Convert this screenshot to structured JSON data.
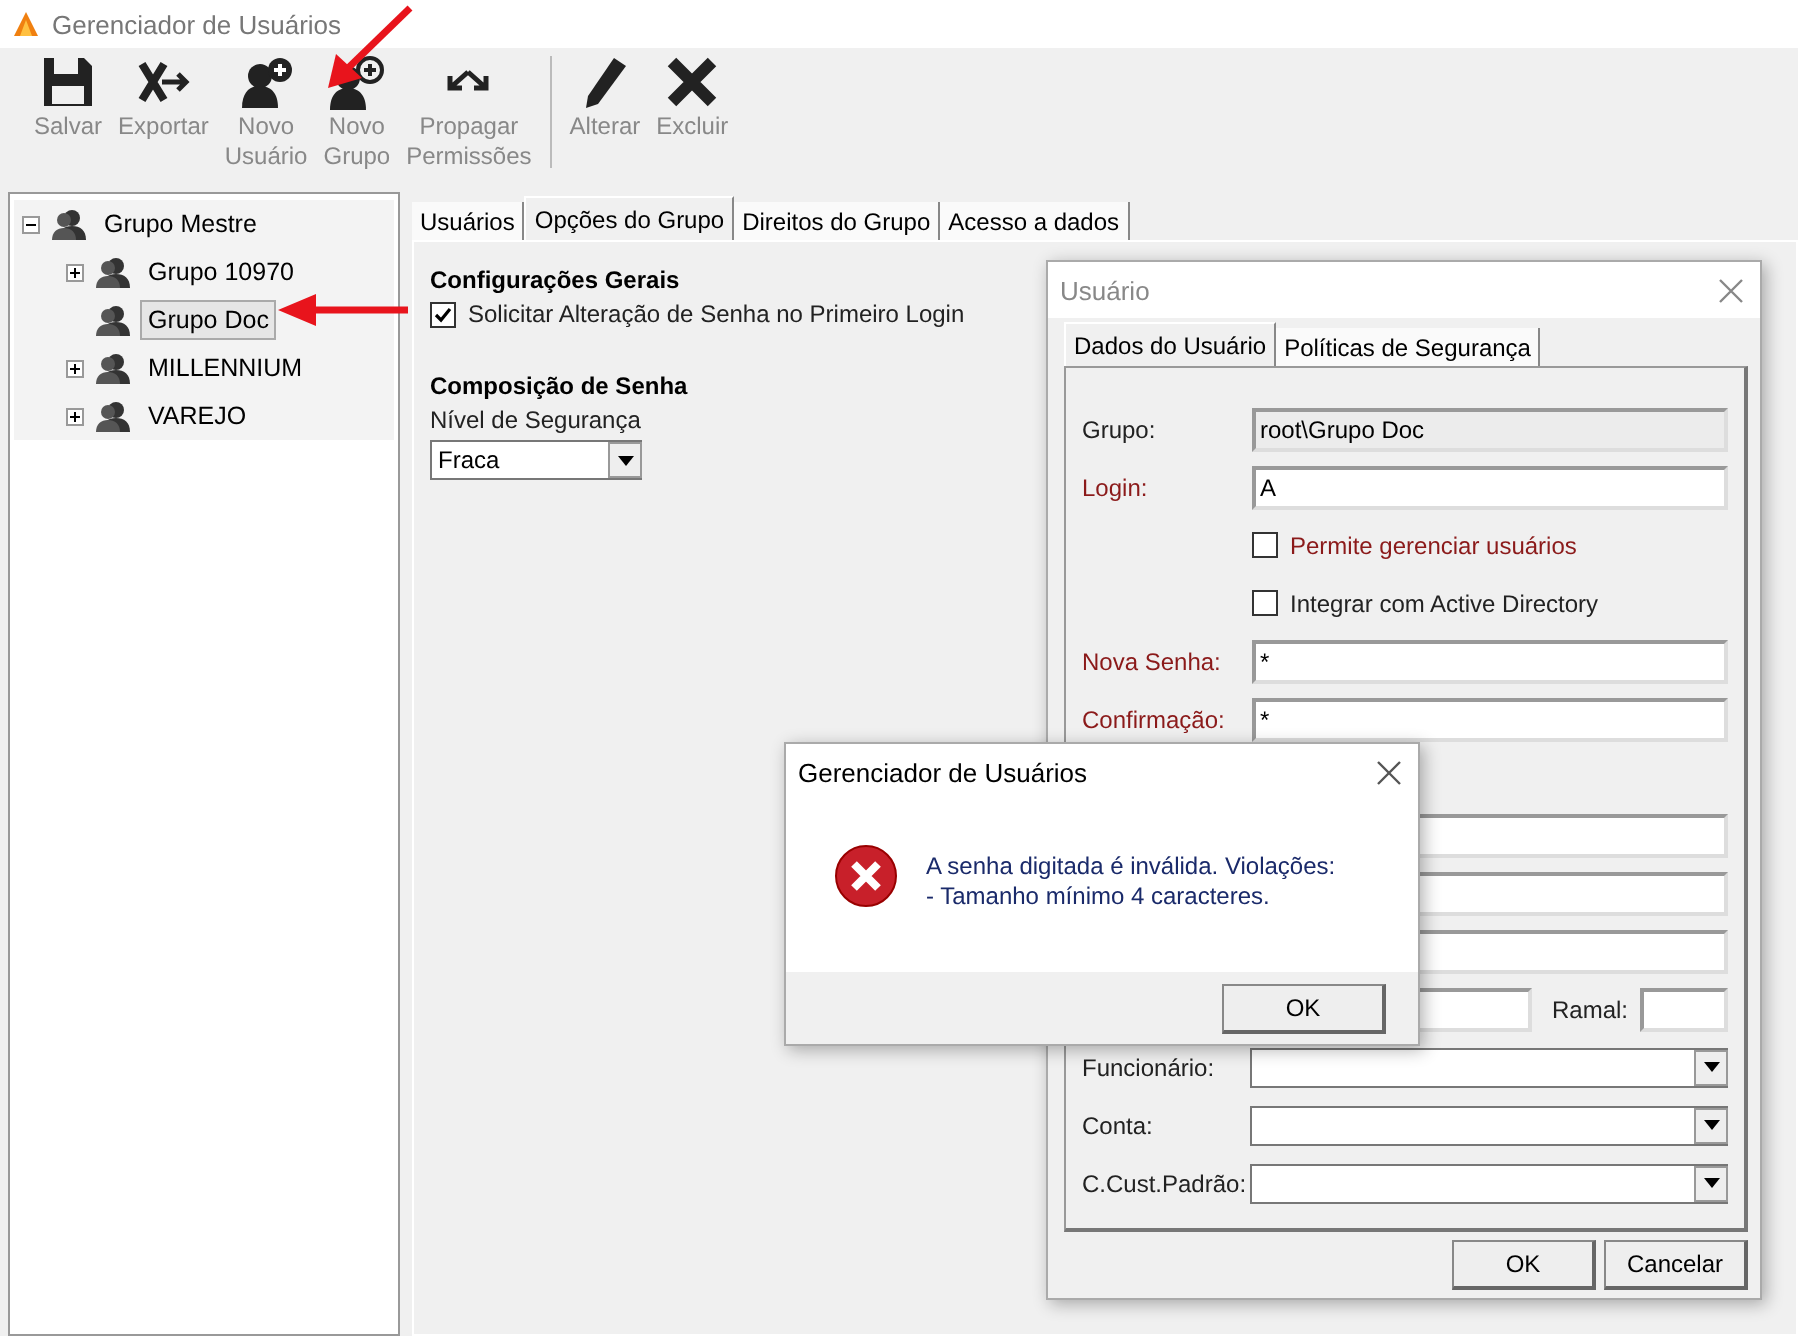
{
  "window": {
    "title": "Gerenciador de Usuários"
  },
  "toolbar": [
    {
      "label": "Salvar",
      "kind": "save"
    },
    {
      "label": "Exportar",
      "kind": "export"
    },
    {
      "label": "Novo\nUsuário",
      "kind": "new-user"
    },
    {
      "label": "Novo\nGrupo",
      "kind": "new-group"
    },
    {
      "label": "Propagar\nPermissões",
      "kind": "propagate"
    },
    {
      "kind": "separator"
    },
    {
      "label": "Alterar",
      "kind": "edit"
    },
    {
      "label": "Excluir",
      "kind": "delete"
    }
  ],
  "tree": [
    {
      "label": "Grupo Mestre",
      "expanded": true,
      "selected": false,
      "children": [
        {
          "label": "Grupo 10970",
          "kind": "folder",
          "expanded": false,
          "selected": false
        },
        {
          "label": "Grupo Doc",
          "kind": "leaf",
          "selected": true
        },
        {
          "label": "MILLENNIUM",
          "kind": "folder",
          "expanded": false,
          "selected": false
        },
        {
          "label": "VAREJO",
          "kind": "folder",
          "expanded": false,
          "selected": false
        }
      ]
    }
  ],
  "tabs": [
    {
      "label": "Usuários",
      "selected": false
    },
    {
      "label": "Opções do Grupo",
      "selected": true
    },
    {
      "label": "Direitos do Grupo",
      "selected": false
    },
    {
      "label": "Acesso a dados",
      "selected": false
    }
  ],
  "group_options": {
    "general_heading": "Configurações Gerais",
    "first_login": {
      "label": "Solicitar Alteração de Senha no Primeiro Login",
      "checked": true
    },
    "password_heading": "Composição de Senha",
    "level_label": "Nível de Segurança",
    "level_value": "Fraca"
  },
  "user_dialog": {
    "title": "Usuário",
    "tabs": [
      {
        "label": "Dados do Usuário",
        "selected": true
      },
      {
        "label": "Políticas de Segurança",
        "selected": false
      }
    ],
    "rows": [
      {
        "kind": "field",
        "label": "Grupo:",
        "value": "root\\Grupo Doc",
        "readonly": true,
        "required": false
      },
      {
        "kind": "field",
        "label": "Login:",
        "value": "A",
        "readonly": false,
        "required": true
      },
      {
        "kind": "checkbox",
        "label": "Permite gerenciar usuários",
        "checked": false,
        "required": true
      },
      {
        "kind": "checkbox",
        "label": "Integrar com Active Directory",
        "checked": false,
        "required": false
      },
      {
        "kind": "field",
        "label": "Nova Senha:",
        "value": "*",
        "readonly": false,
        "required": true
      },
      {
        "kind": "field",
        "label": "Confirmação:",
        "value": "*",
        "readonly": false,
        "required": true
      },
      {
        "kind": "blank"
      },
      {
        "kind": "field",
        "readonly": false
      },
      {
        "kind": "field",
        "readonly": false
      },
      {
        "kind": "field",
        "readonly": false
      },
      {
        "kind": "split",
        "extra_label": "Ramal:"
      },
      {
        "kind": "select",
        "label": "Funcionário:",
        "required": false
      },
      {
        "kind": "select",
        "label": "Conta:",
        "required": false
      },
      {
        "kind": "select",
        "label": "C.Cust.Padrão:",
        "required": false
      }
    ],
    "buttons": [
      "OK",
      "Cancelar"
    ]
  },
  "message_box": {
    "title": "Gerenciador de Usuários",
    "message_lines": [
      "A senha digitada é inválida. Violações:",
      "- Tamanho mínimo 4 caracteres."
    ],
    "button": "OK"
  }
}
